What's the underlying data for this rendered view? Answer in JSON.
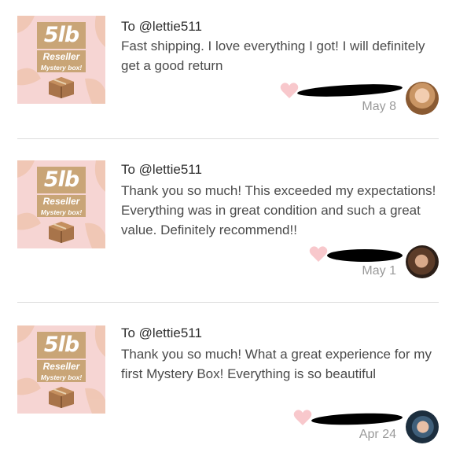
{
  "reviews": [
    {
      "thumb": {
        "weight": "5lb",
        "line1": "Reseller",
        "line2": "Mystery box!"
      },
      "to": "To @lettie511",
      "message": "Fast shipping. I love everything I got! I will definitely get a good return",
      "date": "May 8"
    },
    {
      "thumb": {
        "weight": "5lb",
        "line1": "Reseller",
        "line2": "Mystery box!"
      },
      "to": "To @lettie511",
      "message": "Thank you so much! This exceeded my expectations! Everything was in great condition and such a great value. Definitely recommend!!",
      "date": "May 1"
    },
    {
      "thumb": {
        "weight": "5lb",
        "line1": "Reseller",
        "line2": "Mystery box!"
      },
      "to": "To @lettie511",
      "message": "Thank you so much! What a great experience for my first Mystery Box! Everything is so beautiful",
      "date": "Apr 24"
    }
  ],
  "colors": {
    "thumb_background": "#f6d5d3",
    "badge_tan": "#c9a577",
    "heart_pink": "#f8c8cc",
    "date_gray": "#9a9a9a"
  },
  "icons": [
    "palm-leaf-icon",
    "cardboard-box-icon",
    "heart-icon"
  ]
}
